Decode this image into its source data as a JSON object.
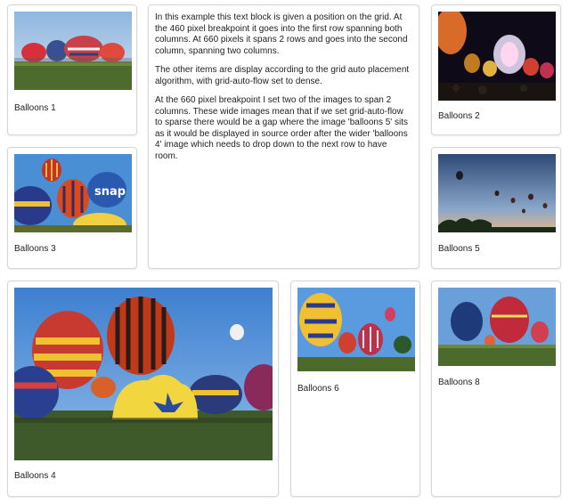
{
  "text_block": {
    "paragraphs": [
      "In this example this text block is given a position on the grid. At the 460 pixel breakpoint it goes into the first row spanning both columns. At 660 pixels it spans 2 rows and goes into the second column, spanning two columns.",
      "The other items are display according to the grid auto placement algorithm, with grid-auto-flow set to dense.",
      "At the 660 pixel breakpoint I set two of the images to span 2 columns. These wide images mean that if we set grid-auto-flow to sparse there would be a gap where the image 'balloons 5' sits as it would be displayed in source order after the wider 'balloons 4' image which needs to drop down to the next row to have room."
    ]
  },
  "items": [
    {
      "caption": "Balloons 1"
    },
    {
      "caption": "Balloons 2"
    },
    {
      "caption": "Balloons 3"
    },
    {
      "caption": "Balloons 4"
    },
    {
      "caption": "Balloons 5"
    },
    {
      "caption": "Balloons 6"
    },
    {
      "caption": "Balloons 8"
    }
  ],
  "image_details": {
    "balloons_3_label": "snap"
  },
  "colors": {
    "card_border": "#d6d6d6",
    "sky_blue": "#4a8fd4",
    "grass_green": "#3f5a2a"
  }
}
